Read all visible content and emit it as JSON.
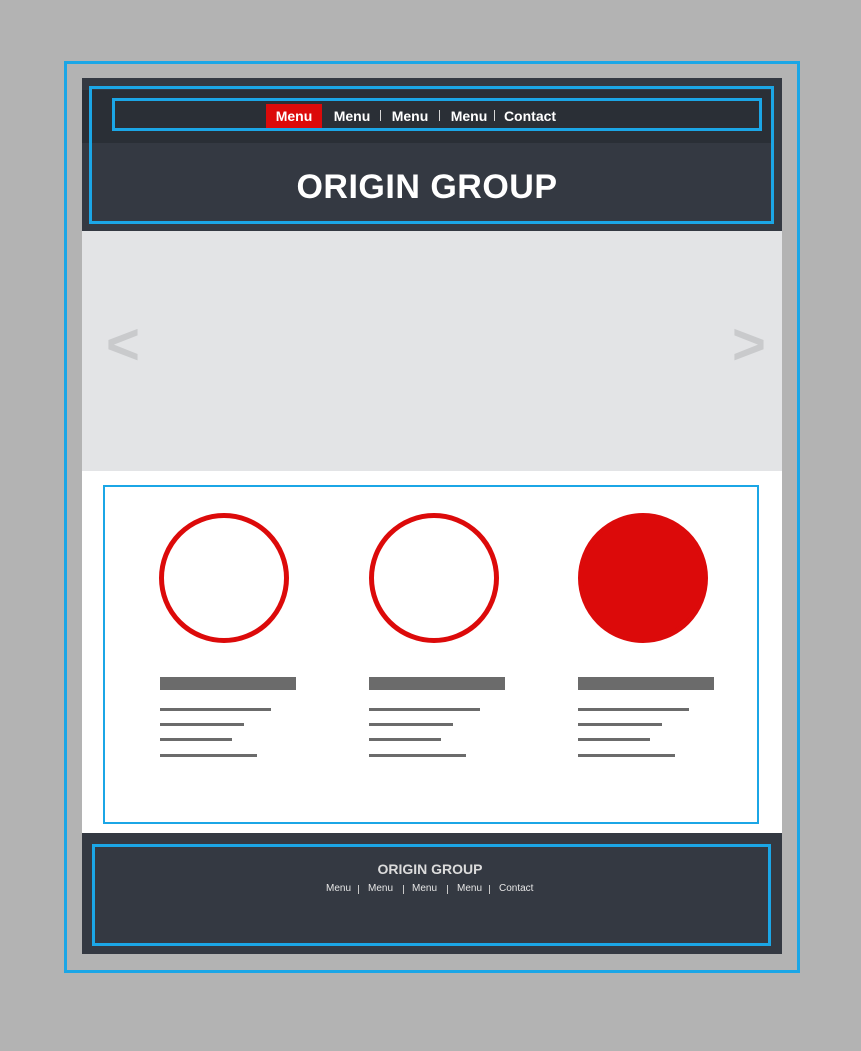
{
  "header": {
    "nav": [
      {
        "label": "Menu",
        "active": true
      },
      {
        "label": "Menu",
        "active": false
      },
      {
        "label": "Menu",
        "active": false
      },
      {
        "label": "Menu",
        "active": false
      },
      {
        "label": "Contact",
        "active": false
      }
    ],
    "title": "ORIGIN GROUP"
  },
  "slider": {
    "prev_icon": "chevron-left-icon",
    "next_icon": "chevron-right-icon",
    "prev_glyph": "<",
    "next_glyph": ">"
  },
  "features": [
    {
      "icon": "outline-circle",
      "filled": false
    },
    {
      "icon": "outline-circle",
      "filled": false
    },
    {
      "icon": "filled-circle",
      "filled": true
    }
  ],
  "footer": {
    "title": "ORIGIN GROUP",
    "nav": [
      "Menu",
      "Menu",
      "Menu",
      "Menu",
      "Contact"
    ]
  },
  "colors": {
    "accent": "#dc0a0a",
    "dark_bg": "#343942",
    "guide": "#1ba6e6",
    "slider_bg": "#e3e4e6",
    "placeholder_text": "#6b6b6b"
  }
}
